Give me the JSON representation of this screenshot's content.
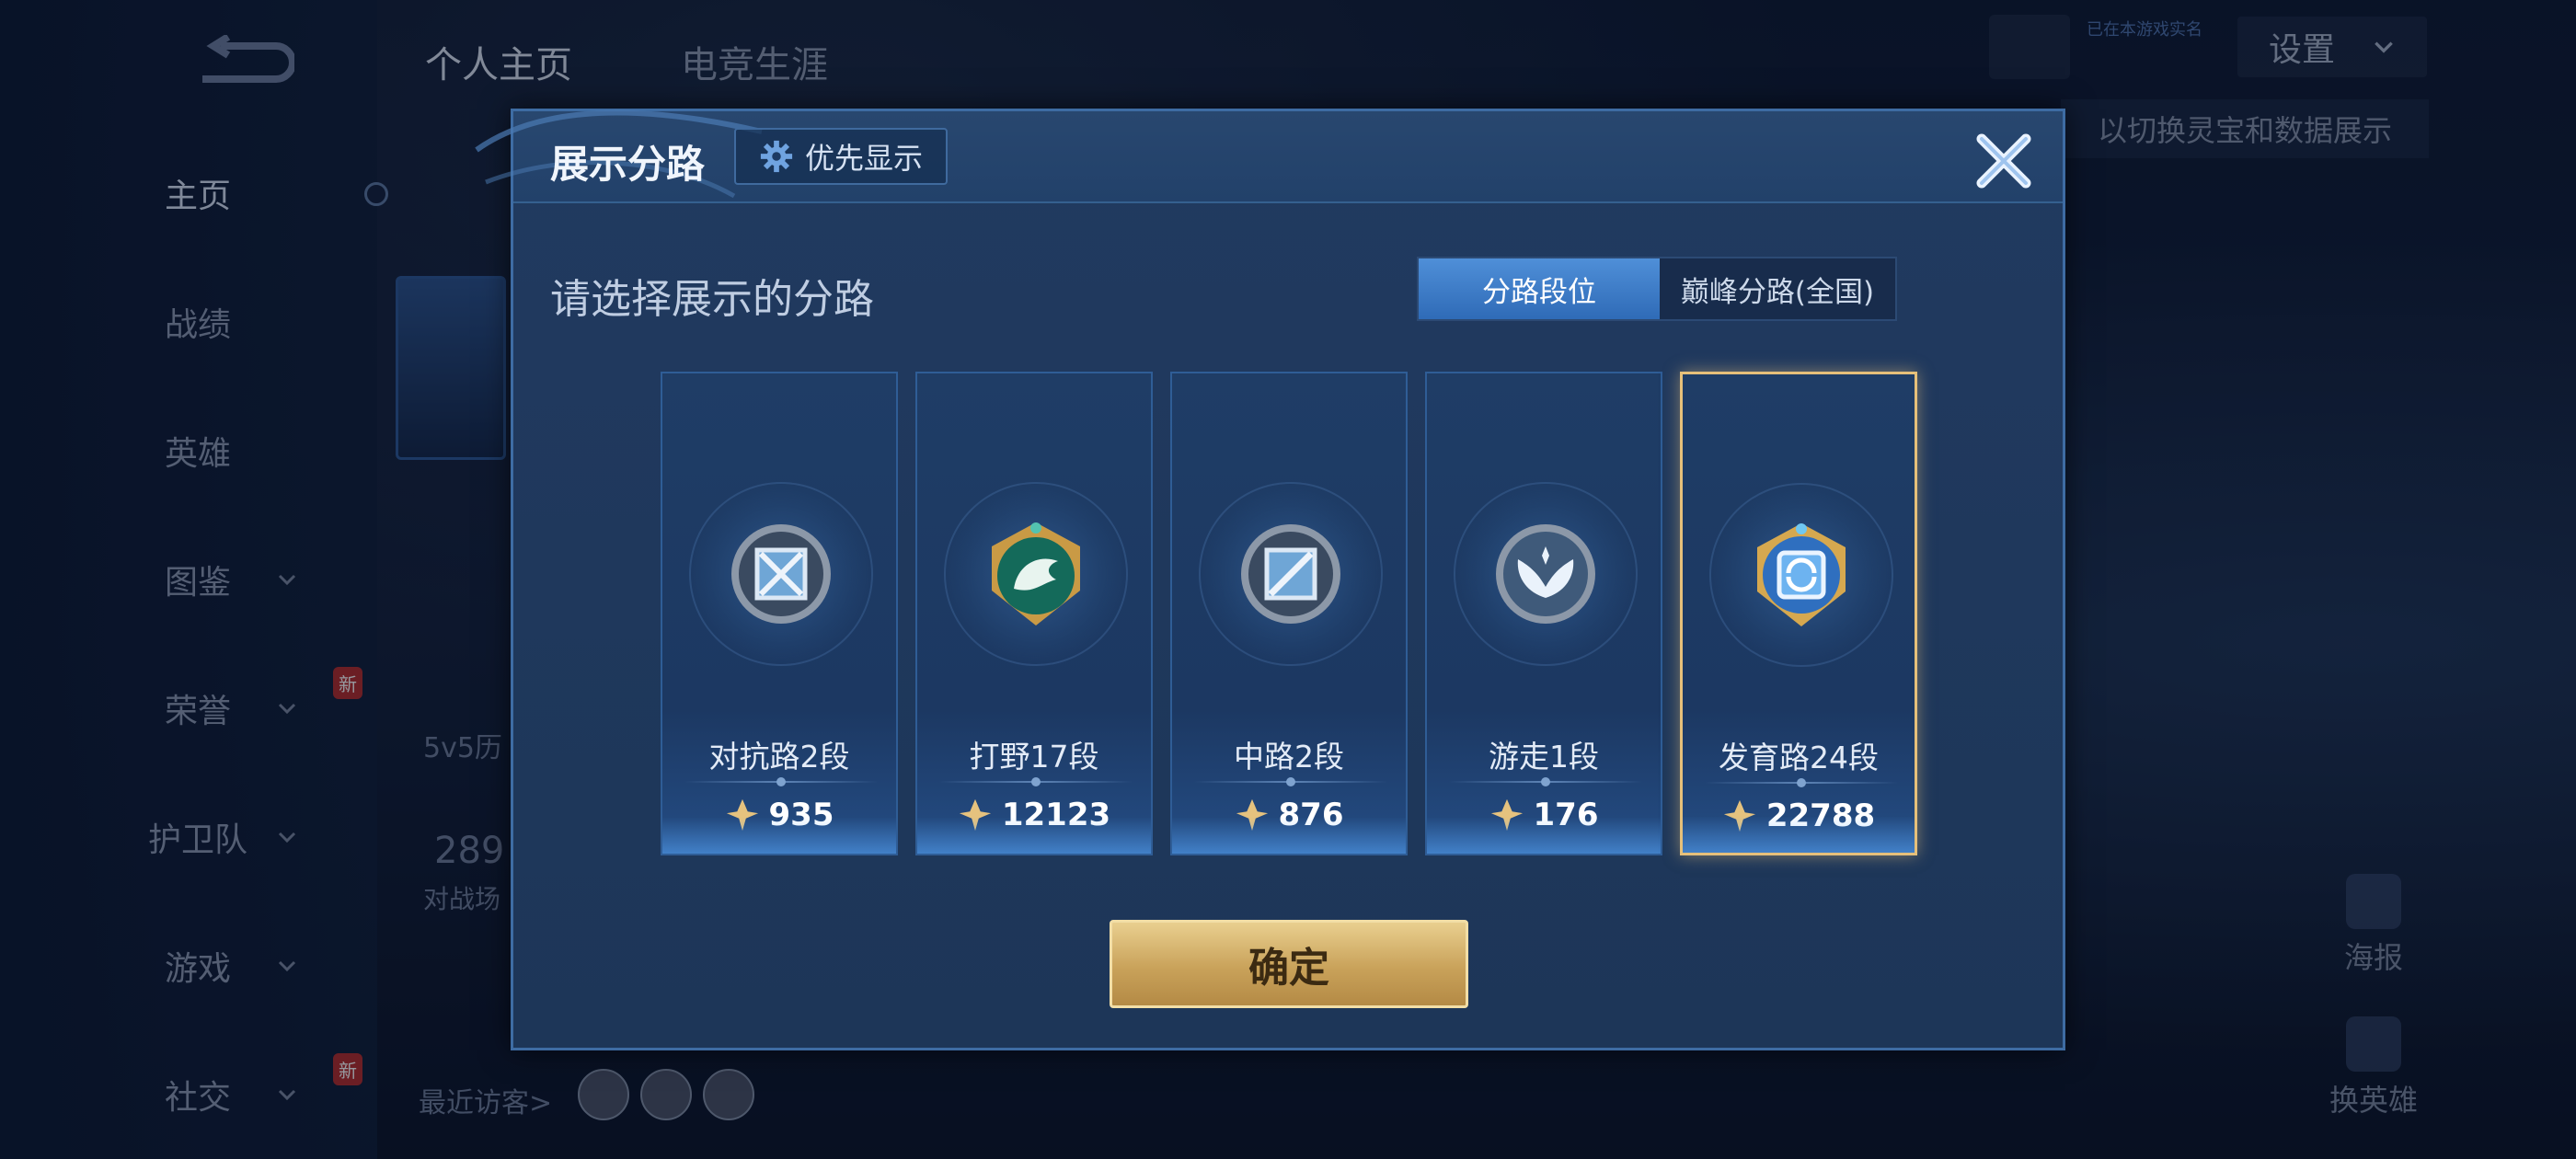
{
  "sidebar": {
    "items": [
      {
        "label": "主页",
        "active": true,
        "chevron": false,
        "new": false
      },
      {
        "label": "战绩",
        "active": false,
        "chevron": false,
        "new": false
      },
      {
        "label": "英雄",
        "active": false,
        "chevron": false,
        "new": false
      },
      {
        "label": "图鉴",
        "active": false,
        "chevron": true,
        "new": false
      },
      {
        "label": "荣誉",
        "active": false,
        "chevron": true,
        "new": true
      },
      {
        "label": "护卫队",
        "active": false,
        "chevron": true,
        "new": false
      },
      {
        "label": "游戏",
        "active": false,
        "chevron": true,
        "new": false
      },
      {
        "label": "社交",
        "active": false,
        "chevron": true,
        "new": true
      }
    ],
    "new_badge": "新"
  },
  "top_tabs": [
    "个人主页",
    "电竞生涯"
  ],
  "background": {
    "history_label": "5v5历",
    "count_value": "289",
    "count_label": "对战场",
    "recent_visitors": "最近访客>",
    "settings": "设置",
    "hint": "以切换灵宝和数据展示",
    "online_badge": "已在本游戏实名",
    "poster": "海报",
    "change_hero": "换英雄"
  },
  "modal": {
    "title": "展示分路",
    "priority_button": "优先显示",
    "subtitle": "请选择展示的分路",
    "toggle": {
      "active": "分路段位",
      "inactive": "巅峰分路(全国)"
    },
    "cards": [
      {
        "label": "对抗路2段",
        "score": "935",
        "icon": "clash-lane-emblem",
        "selected": false
      },
      {
        "label": "打野17段",
        "score": "12123",
        "icon": "jungle-dragon-emblem",
        "selected": false
      },
      {
        "label": "中路2段",
        "score": "876",
        "icon": "mid-lane-emblem",
        "selected": false
      },
      {
        "label": "游走1段",
        "score": "176",
        "icon": "roam-wings-emblem",
        "selected": false
      },
      {
        "label": "发育路24段",
        "score": "22788",
        "icon": "farm-lane-emblem",
        "selected": true
      }
    ],
    "confirm": "确定"
  },
  "colors": {
    "modal_bg": "#213a60",
    "toggle_active": "#3f7fcb",
    "selected_border": "#e6c07a",
    "confirm_gold": "#c9a25a"
  }
}
